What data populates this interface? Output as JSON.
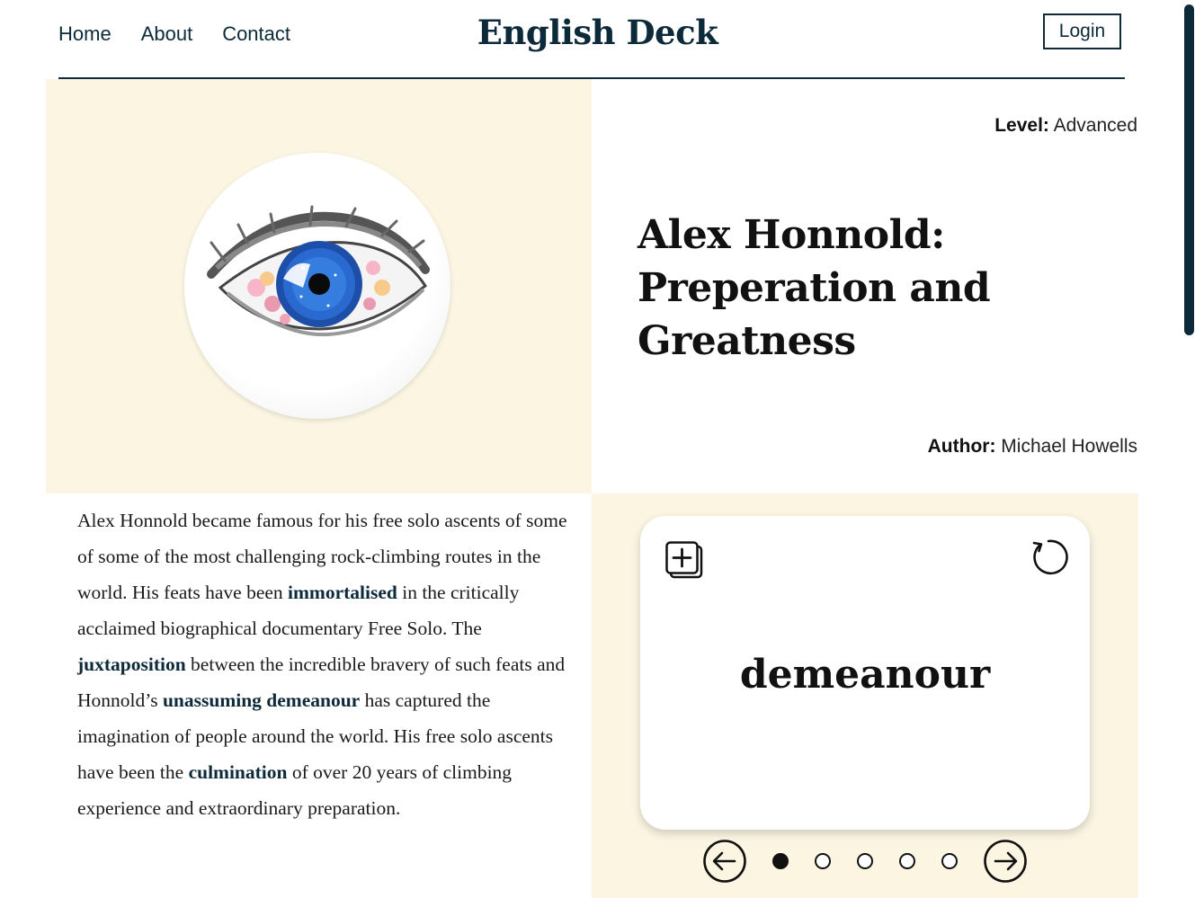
{
  "header": {
    "nav": [
      {
        "label": "Home"
      },
      {
        "label": "About"
      },
      {
        "label": "Contact"
      }
    ],
    "brand": "English Deck",
    "login_label": "Login"
  },
  "hero": {
    "level_label": "Level:",
    "level_value": "Advanced",
    "title": "Alex Honnold: Preperation and Greatness",
    "author_label": "Author:",
    "author_value": "Michael Howells",
    "image_icon": "eye-illustration"
  },
  "article": {
    "segments": [
      {
        "t": "Alex Honnold became famous for his free solo ascents of some of some of the most challenging rock-climbing routes in the world. His feats have been "
      },
      {
        "t": "immortalised",
        "kw": true
      },
      {
        "t": " in the critically acclaimed biographical documentary Free Solo. The "
      },
      {
        "t": "juxtaposition",
        "kw": true
      },
      {
        "t": " between the incredible bravery of such feats and Honnold’s "
      },
      {
        "t": "unassuming demeanour",
        "kw": true
      },
      {
        "t": " has captured the imagination of people around the world. His free solo ascents have been the "
      },
      {
        "t": "culmination",
        "kw": true
      },
      {
        "t": " of over 20 years of climbing experience and extraordinary preparation."
      }
    ]
  },
  "flashcard": {
    "word": "demeanour",
    "add_icon": "add-to-deck-icon",
    "flip_icon": "rotate-icon",
    "prev_icon": "arrow-left-icon",
    "next_icon": "arrow-right-icon",
    "total_cards": 5,
    "current_index": 0
  },
  "colors": {
    "accent": "#0c2a3a",
    "cream": "#fbf5e2"
  }
}
